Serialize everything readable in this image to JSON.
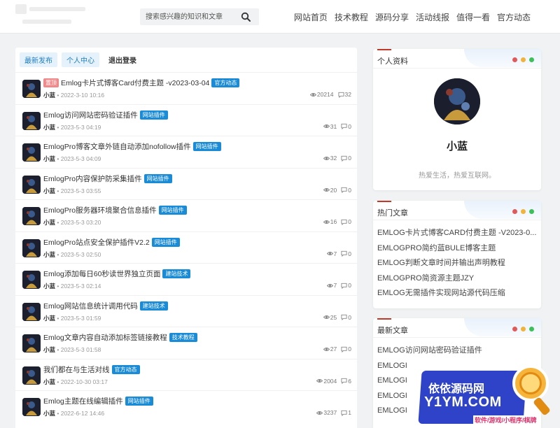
{
  "header": {
    "search_placeholder": "搜索感兴趣的知识和文章",
    "nav": [
      "网站首页",
      "技术教程",
      "源码分享",
      "活动线报",
      "值得一看",
      "官方动态"
    ]
  },
  "tabs": [
    "最新发布",
    "个人中心",
    "退出登录"
  ],
  "posts": [
    {
      "top": "置顶",
      "title": "Emlog卡片式博客Card付费主题 -v2023-03-04",
      "category": "官方动态",
      "author": "小蓝",
      "date": "2022-3-10 10:16",
      "views": "20214",
      "comments": "32"
    },
    {
      "top": "",
      "title": "Emlog访问网站密码验证插件",
      "category": "网站插件",
      "author": "小蓝",
      "date": "2023-5-3 04:19",
      "views": "31",
      "comments": "0"
    },
    {
      "top": "",
      "title": "EmlogPro博客文章外链自动添加nofollow插件",
      "category": "网站插件",
      "author": "小蓝",
      "date": "2023-5-3 04:09",
      "views": "32",
      "comments": "0"
    },
    {
      "top": "",
      "title": "EmlogPro内容保护防采集插件",
      "category": "网站插件",
      "author": "小蓝",
      "date": "2023-5-3 03:55",
      "views": "20",
      "comments": "0"
    },
    {
      "top": "",
      "title": "EmlogPro服务器环境聚合信息插件",
      "category": "网站插件",
      "author": "小蓝",
      "date": "2023-5-3 03:20",
      "views": "16",
      "comments": "0"
    },
    {
      "top": "",
      "title": "EmlogPro站点安全保护插件V2.2",
      "category": "网站插件",
      "author": "小蓝",
      "date": "2023-5-3 02:50",
      "views": "7",
      "comments": "0"
    },
    {
      "top": "",
      "title": "Emlog添加每日60秒读世界独立页面",
      "category": "建站技术",
      "author": "小蓝",
      "date": "2023-5-3 02:14",
      "views": "7",
      "comments": "0"
    },
    {
      "top": "",
      "title": "Emlog网站信息统计调用代码",
      "category": "建站技术",
      "author": "小蓝",
      "date": "2023-5-3 01:59",
      "views": "25",
      "comments": "0"
    },
    {
      "top": "",
      "title": "Emlog文章内容自动添加标签链接教程",
      "category": "技术教程",
      "author": "小蓝",
      "date": "2023-5-3 01:58",
      "views": "27",
      "comments": "0"
    },
    {
      "top": "",
      "title": "我们都在与生活对线",
      "category": "官方动态",
      "author": "小蓝",
      "date": "2022-10-30 03:17",
      "views": "2004",
      "comments": "6"
    },
    {
      "top": "",
      "title": "Emlog主题在线编辑插件",
      "category": "网站插件",
      "author": "小蓝",
      "date": "2022-6-12 14:46",
      "views": "3237",
      "comments": "1"
    }
  ],
  "profile": {
    "heading": "个人资料",
    "name": "小蓝",
    "bio": "热爱生活，热爱互联网。"
  },
  "hot": {
    "heading": "热门文章",
    "items": [
      "EMLOG卡片式博客CARD付费主题 -V2023-0...",
      "EMLOGPRO简约蓝BULE博客主题",
      "EMLOG判断文章时间并输出声明教程",
      "EMLOGPRO简资源主题JZY",
      "EMLOG无需插件实现网站源代码压缩"
    ]
  },
  "latest": {
    "heading": "最新文章",
    "items": [
      "EMLOG访问网站密码验证插件",
      "EMLOGI",
      "EMLOGI",
      "EMLOGI",
      "EMLOGI"
    ]
  },
  "watermark": {
    "line1": "依依源码网",
    "line2": "Y1YM.COM",
    "line3": "软件/游戏/小程序/棋牌"
  },
  "colors": {
    "category": "#1a8bd6",
    "top_badge": "#f08a8a",
    "tab_active": "#1f7fbf",
    "dot_red": "#e05a5a",
    "dot_yellow": "#f0b43c",
    "dot_green": "#3cc05a"
  }
}
